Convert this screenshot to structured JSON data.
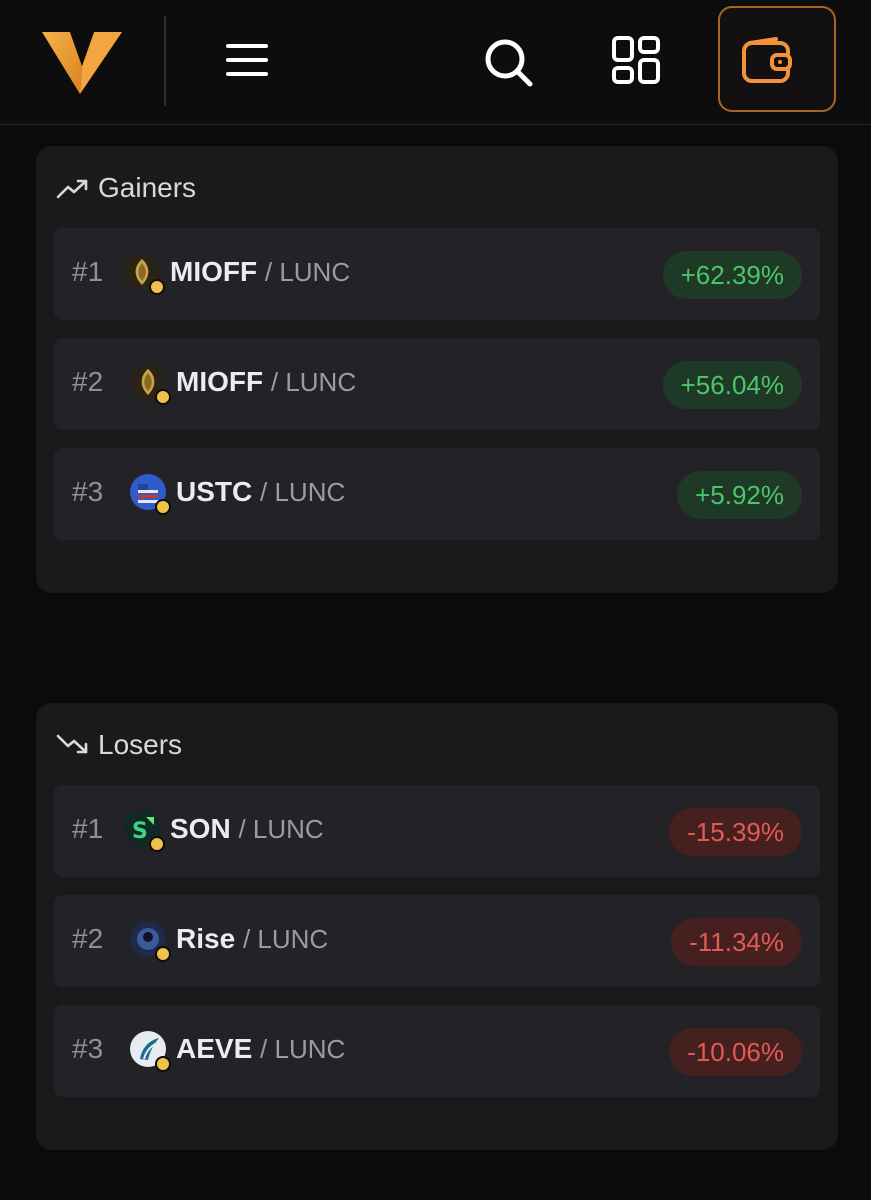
{
  "header": {
    "logo": "v-logo",
    "menu_icon": "hamburger-menu-icon",
    "search_icon": "search-icon",
    "grid_icon": "apps-grid-icon",
    "wallet_icon": "wallet-icon",
    "accent": "#a86524"
  },
  "gainers": {
    "title": "Gainers",
    "icon": "trending-up-icon",
    "rows": [
      {
        "rank": "#1",
        "symbol": "MIOFF",
        "quote": "/ LUNC",
        "change": "+62.39%"
      },
      {
        "rank": "#2",
        "symbol": "MIOFF",
        "quote": "/ LUNC",
        "change": "+56.04%"
      },
      {
        "rank": "#3",
        "symbol": "USTC",
        "quote": "/ LUNC",
        "change": "+5.92%"
      }
    ]
  },
  "losers": {
    "title": "Losers",
    "icon": "trending-down-icon",
    "rows": [
      {
        "rank": "#1",
        "symbol": "SON",
        "quote": "/ LUNC",
        "change": "-15.39%"
      },
      {
        "rank": "#2",
        "symbol": "Rise",
        "quote": "/ LUNC",
        "change": "-11.34%"
      },
      {
        "rank": "#3",
        "symbol": "AEVE",
        "quote": "/ LUNC",
        "change": "-10.06%"
      }
    ]
  },
  "colors": {
    "positive": "#4cc46a",
    "negative": "#e25a54",
    "panel": "#1a1a1d",
    "row": "#232327"
  }
}
